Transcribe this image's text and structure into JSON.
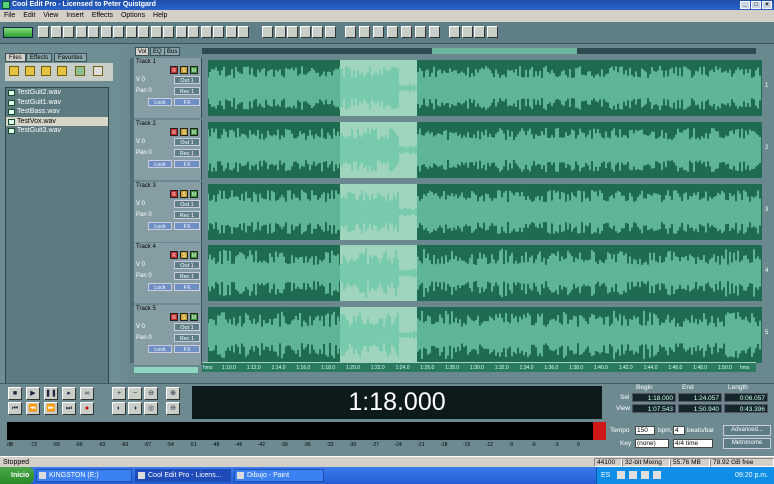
{
  "window": {
    "title": "Cool Edit Pro  - Licensed to Peter Quistgard"
  },
  "menu": [
    "File",
    "Edit",
    "View",
    "Insert",
    "Effects",
    "Options",
    "Help"
  ],
  "left_panel": {
    "tabs": [
      "Files",
      "Effects",
      "Favorites"
    ],
    "files": [
      "TestGuit2.wav",
      "TestGuit1.wav",
      "TestBass.wav",
      "TestVox.wav",
      "TestGuit3.wav"
    ],
    "selected_index": 3
  },
  "view_tabs": [
    "Vol",
    "EQ",
    "Bus"
  ],
  "tracks": [
    {
      "name": "Track 1",
      "vol": "V 0",
      "pan": "Pan 0",
      "out": "Out 1",
      "rec": "Rec 1",
      "lock": "Lock",
      "fx": "FX",
      "num": "1"
    },
    {
      "name": "Track 2",
      "vol": "V 0",
      "pan": "Pan 0",
      "out": "Out 1",
      "rec": "Rec 1",
      "lock": "Lock",
      "fx": "FX",
      "num": "2"
    },
    {
      "name": "Track 3",
      "vol": "V 0",
      "pan": "Pan 0",
      "out": "Out 1",
      "rec": "Rec 1",
      "lock": "Lock",
      "fx": "FX",
      "num": "3"
    },
    {
      "name": "Track 4",
      "vol": "V 0",
      "pan": "Pan 0",
      "out": "Out 1",
      "rec": "Rec 1",
      "lock": "Lock",
      "fx": "FX",
      "num": "4"
    },
    {
      "name": "Track 5",
      "vol": "V 0",
      "pan": "Pan 0",
      "out": "Out 1",
      "rec": "Rec 1",
      "lock": "Lock",
      "fx": "FX",
      "num": "5"
    }
  ],
  "track_button_labels": {
    "record": "R",
    "solo": "S",
    "mute": "M"
  },
  "ruler": {
    "ticks": [
      "hms",
      "1:10.0",
      "1:12.0",
      "1:14.0",
      "1:16.0",
      "1:18.0",
      "1:20.0",
      "1:22.0",
      "1:24.0",
      "1:26.0",
      "1:28.0",
      "1:30.0",
      "1:32.0",
      "1:34.0",
      "1:36.0",
      "1:38.0",
      "1:40.0",
      "1:42.0",
      "1:44.0",
      "1:46.0",
      "1:48.0",
      "1:50.0",
      "hms"
    ]
  },
  "time_display": "1:18.000",
  "selection_info": {
    "headers": [
      "Begin",
      "End",
      "Length"
    ],
    "sel_label": "Sel",
    "view_label": "View",
    "sel": [
      "1:18.000",
      "1:24.057",
      "0:06.057"
    ],
    "view": [
      "1:07.543",
      "1:50.940",
      "0:43.396"
    ]
  },
  "level_scale": [
    "dB",
    "-72",
    "-69",
    "-66",
    "-63",
    "-60",
    "-57",
    "-54",
    "-51",
    "-48",
    "-45",
    "-42",
    "-39",
    "-36",
    "-33",
    "-30",
    "-27",
    "-24",
    "-21",
    "-18",
    "-15",
    "-12",
    "-9",
    "-6",
    "-3",
    "0"
  ],
  "tempo": {
    "tempo_label": "Tempo",
    "tempo_value": "150",
    "bpm_label": "bpm,",
    "beats_value": "4",
    "beats_label": "beats/bar",
    "advanced_label": "Advanced...",
    "key_label": "Key",
    "key_value": "(none)",
    "time_sig": "4/4 time",
    "metronome_label": "Metronome"
  },
  "status": {
    "left": "Stopped",
    "sample_rate": "44100",
    "mixing": "32-bit Mixing",
    "memory": "55.76 MB",
    "disk_free": "78.92 GB free"
  },
  "taskbar": {
    "start": "Inicio",
    "tasks": [
      "KINGSTON (E:)",
      "Cool Edit Pro  - Licens...",
      "Dibujo - Paint"
    ],
    "active_task": 1,
    "lang": "ES",
    "clock": "09:20 p.m."
  },
  "colors": {
    "wave_bg": "#1f6b52",
    "wave_fg": "#6fc8a8",
    "selection": "#9fd4bd",
    "time_bg": "#0d1a1c"
  }
}
